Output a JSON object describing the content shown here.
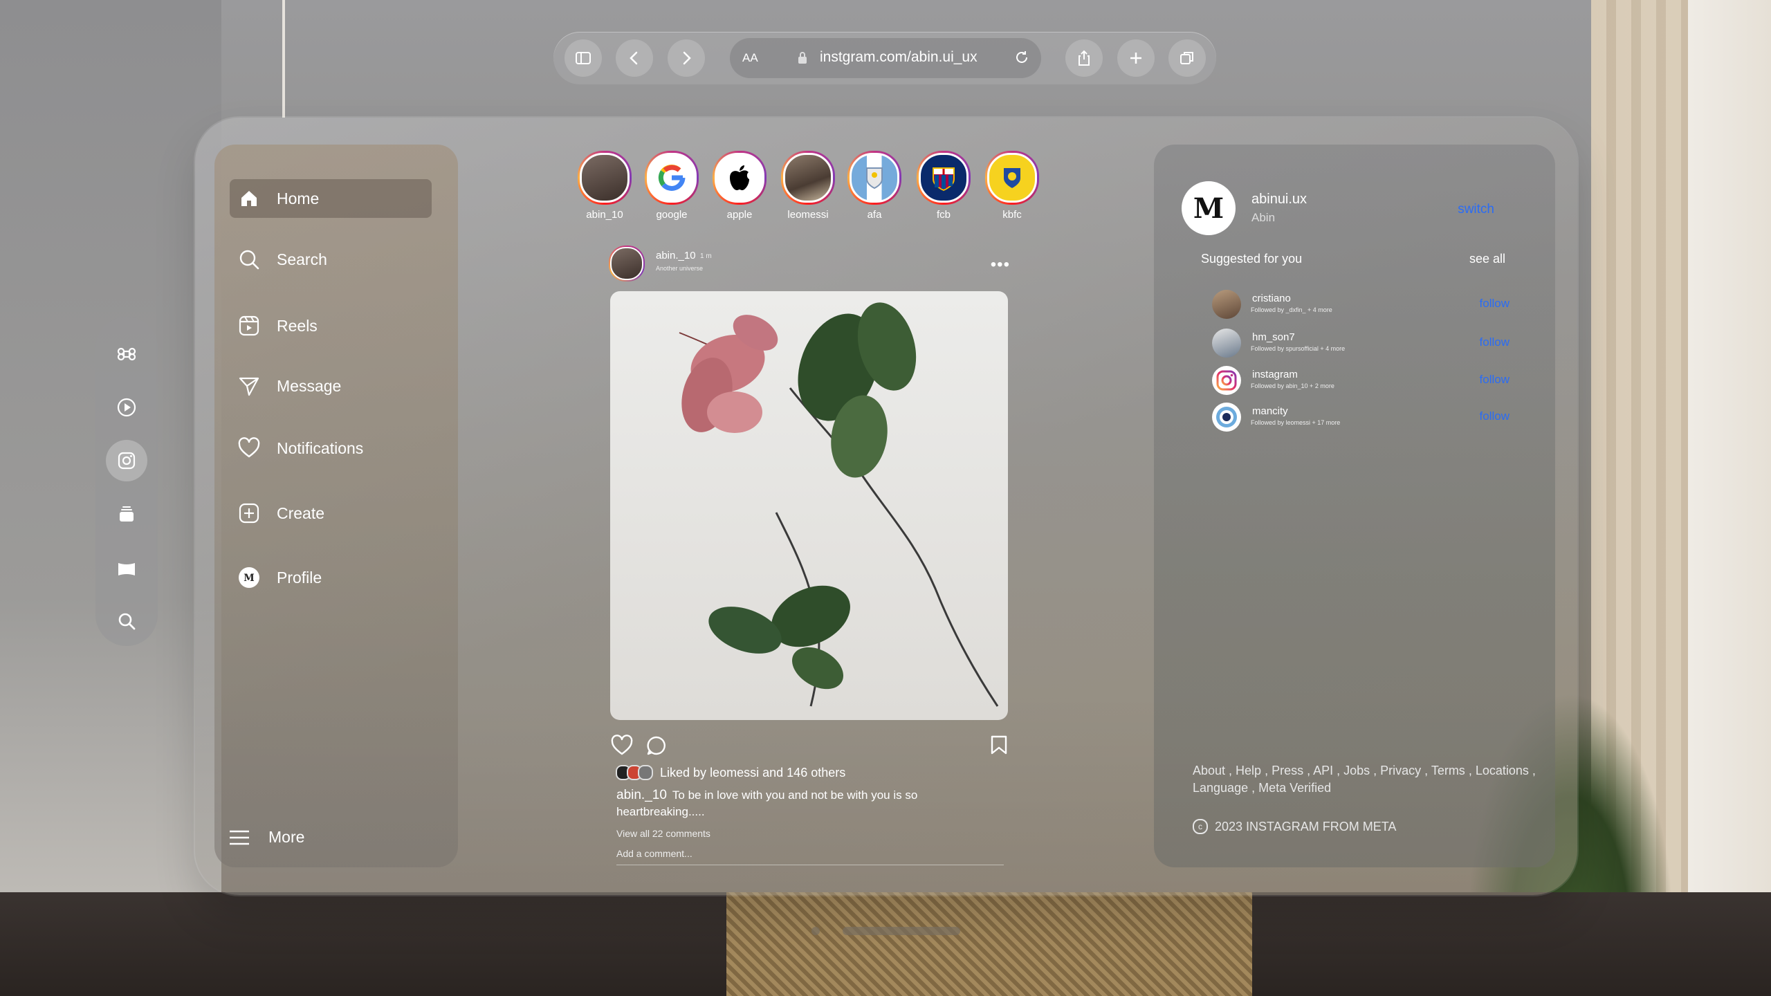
{
  "browser": {
    "text_size_label": "AA",
    "url": "instgram.com/abin.ui_ux"
  },
  "sidebar": {
    "items": [
      {
        "label": "Home",
        "icon": "home-icon"
      },
      {
        "label": "Search",
        "icon": "search-icon"
      },
      {
        "label": "Reels",
        "icon": "reels-icon"
      },
      {
        "label": "Message",
        "icon": "send-icon"
      },
      {
        "label": "Notifications",
        "icon": "heart-icon"
      },
      {
        "label": "Create",
        "icon": "plus-square-icon"
      },
      {
        "label": "Profile",
        "icon": "profile-avatar-icon"
      }
    ],
    "more_label": "More"
  },
  "dock": {
    "icons": [
      "command-icon",
      "play-icon",
      "instagram-icon",
      "stack-icon",
      "map-icon",
      "search-icon"
    ]
  },
  "stories": [
    {
      "name": "abin_10"
    },
    {
      "name": "google"
    },
    {
      "name": "apple"
    },
    {
      "name": "leomessi"
    },
    {
      "name": "afa"
    },
    {
      "name": "fcb"
    },
    {
      "name": "kbfc"
    }
  ],
  "post": {
    "username": "abin._10",
    "time": "1 m",
    "subtitle": "Another universe",
    "liked_by_prefix": "Liked by",
    "liked_by_user": "leomessi",
    "liked_by_and": "and",
    "liked_by_others": "146 others",
    "caption_user": "abin._10",
    "caption_text": "To be in love with you and not be with you is so heartbreaking.....",
    "view_comments": "View all 22 comments",
    "add_comment_placeholder": "Add a comment..."
  },
  "right_panel": {
    "username": "abinui.ux",
    "name": "Abin",
    "switch_label": "switch",
    "suggested_label": "Suggested for you",
    "see_all_label": "see all",
    "suggestions": [
      {
        "name": "cristiano",
        "followed_by": "Followed by _dxfin_ + 4 more",
        "action": "follow"
      },
      {
        "name": "hm_son7",
        "followed_by": "Followed by spursofficial + 4 more",
        "action": "follow"
      },
      {
        "name": "instagram",
        "followed_by": "Followed by abin_10 + 2 more",
        "action": "follow"
      },
      {
        "name": "mancity",
        "followed_by": "Followed by leomessi + 17 more",
        "action": "follow"
      }
    ],
    "footer_links": "About , Help , Press , API , Jobs , Privacy , Terms , Locations , Language , Meta Verified",
    "copyright": "2023 INSTAGRAM FROM META"
  },
  "colors": {
    "accent_link": "#2a6cf5",
    "story_ring": "#c13584"
  }
}
